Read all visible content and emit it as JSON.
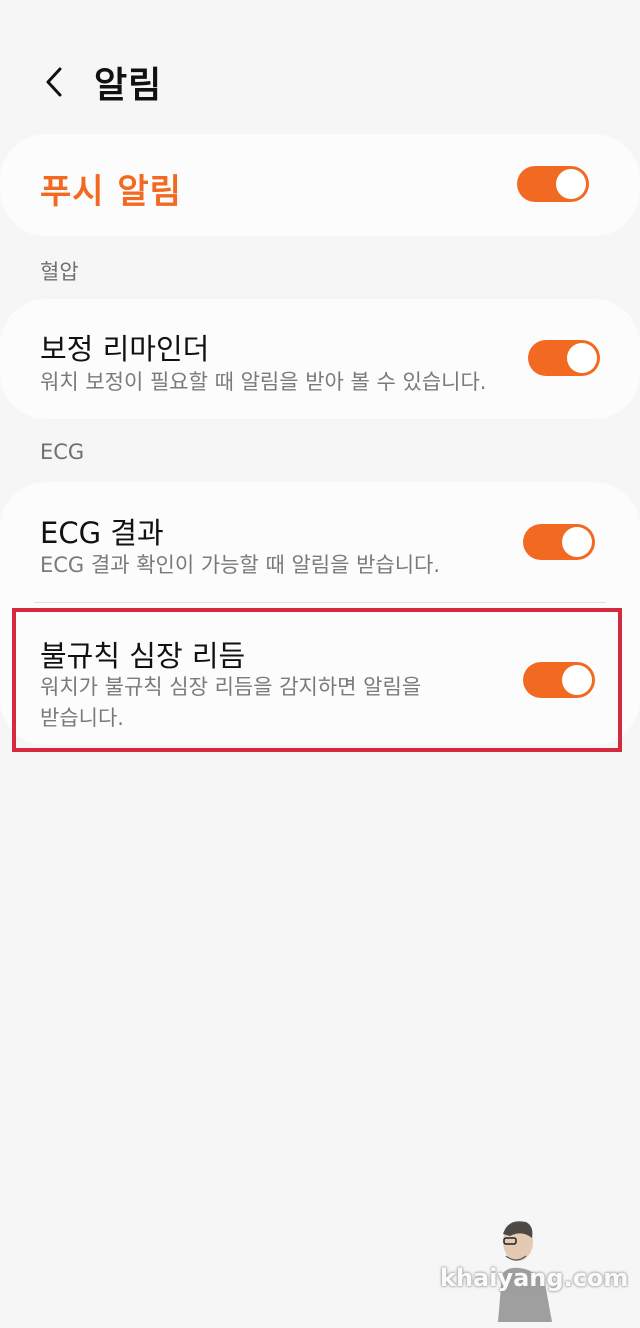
{
  "header": {
    "back_icon": "chevron-left-icon",
    "title": "알림"
  },
  "push": {
    "label": "푸시 알림",
    "enabled": true
  },
  "sections": {
    "bp": {
      "header": "혈압",
      "items": [
        {
          "title": "보정 리마인더",
          "desc": "워치 보정이 필요할 때 알림을 받아 볼 수 있습니다.",
          "enabled": true
        }
      ]
    },
    "ecg": {
      "header": "ECG",
      "items": [
        {
          "title": "ECG 결과",
          "desc": "ECG 결과 확인이 가능할 때 알림을 받습니다.",
          "enabled": true
        },
        {
          "title": "불규칙 심장 리듬",
          "desc_line1": "워치가 불규칙 심장 리듬을 감지하면 알림을",
          "desc_line2": "받습니다.",
          "enabled": true
        }
      ]
    }
  },
  "watermark": {
    "text": "khaiyang.com"
  },
  "colors": {
    "accent": "#f26a22",
    "highlight_border": "#d42a3e",
    "background": "#f6f6f6",
    "card": "#fcfcfc"
  }
}
